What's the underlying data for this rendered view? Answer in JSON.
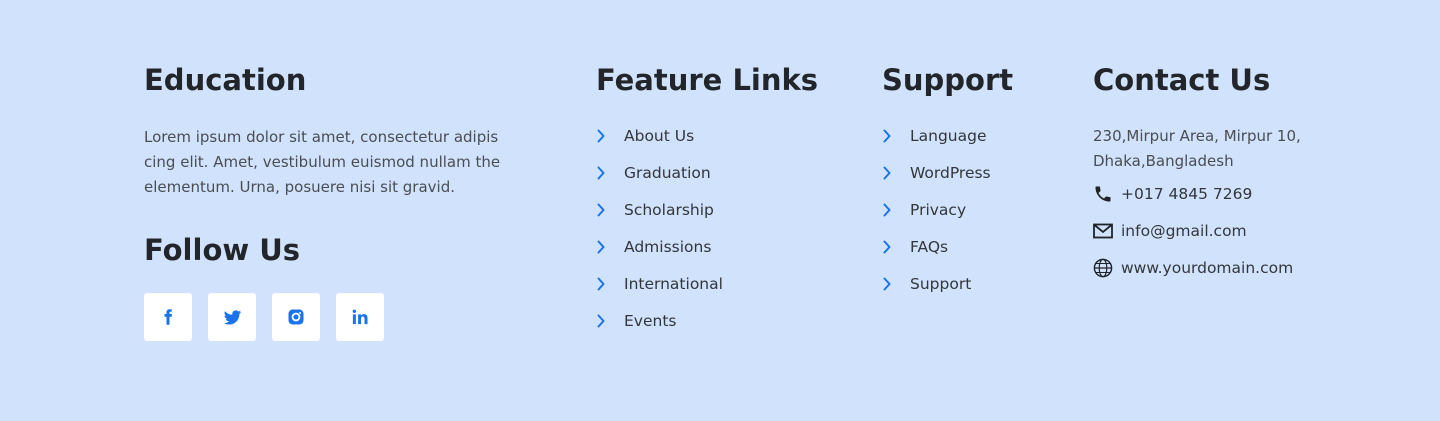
{
  "about": {
    "title": "Education",
    "text": "Lorem ipsum dolor sit amet, consectetur adipis cing elit. Amet, vestibulum euismod nullam the elementum. Urna, posuere nisi sit gravid."
  },
  "follow": {
    "title": "Follow Us",
    "socials": [
      {
        "icon": "facebook-icon"
      },
      {
        "icon": "twitter-icon"
      },
      {
        "icon": "instagram-icon"
      },
      {
        "icon": "linkedin-icon"
      }
    ]
  },
  "feature_links": {
    "title": "Feature Links",
    "items": [
      "About Us",
      "Graduation",
      "Scholarship",
      "Admissions",
      "International",
      "Events"
    ]
  },
  "support": {
    "title": "Support",
    "items": [
      "Language",
      "WordPress",
      "Privacy",
      "FAQs",
      "Support"
    ]
  },
  "contact": {
    "title": "Contact Us",
    "address_line1": "230,Mirpur Area, Mirpur 10,",
    "address_line2": "Dhaka,Bangladesh",
    "phone": "+017 4845 7269",
    "email": "info@gmail.com",
    "website": "www.yourdomain.com"
  },
  "colors": {
    "background": "#d1e3fc",
    "accent": "#1a73e8",
    "heading": "#22252a",
    "text": "#4a4d52"
  }
}
